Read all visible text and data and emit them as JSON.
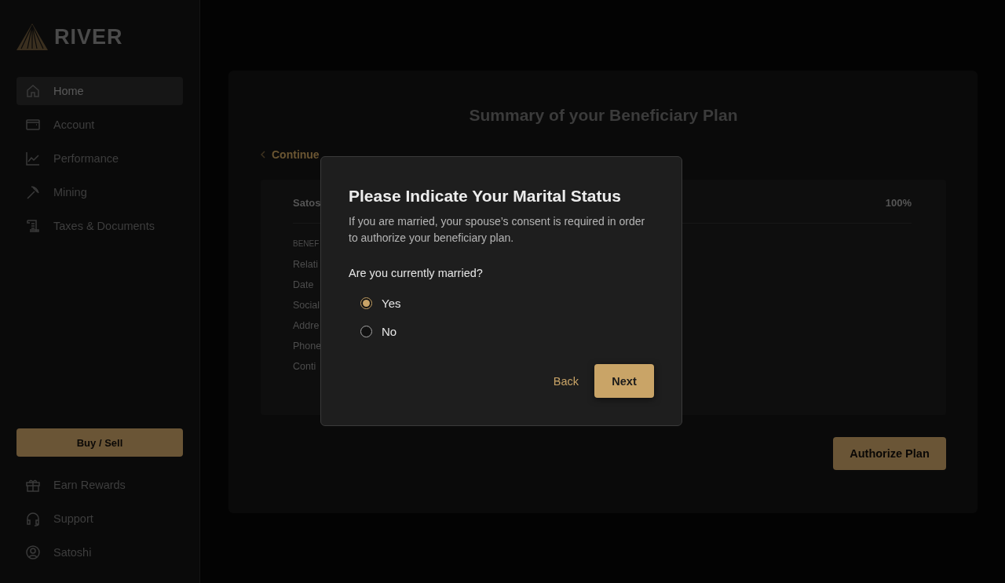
{
  "sidebar": {
    "logo": "RIVER",
    "items": [
      {
        "label": "Home",
        "selected": true
      },
      {
        "label": "Account",
        "selected": false
      },
      {
        "label": "Performance",
        "selected": false
      },
      {
        "label": "Mining",
        "selected": false
      },
      {
        "label": "Taxes & Documents",
        "selected": false
      }
    ],
    "action": "Buy / Sell",
    "footer_items": [
      {
        "label": "Earn Rewards"
      },
      {
        "label": "Support"
      },
      {
        "label": "Satoshi"
      }
    ]
  },
  "page": {
    "title": "Summary of your Beneficiary Plan",
    "back_link": "Continue",
    "beneficiary": {
      "name": "Satos",
      "share": "100%",
      "section": "BENEF",
      "fields": [
        "Relati",
        "Date",
        "Social",
        "Addre",
        "Phone",
        "Conti"
      ]
    },
    "authorize": "Authorize Plan"
  },
  "dialog": {
    "title": "Please Indicate Your Marital Status",
    "text": "If you are married, your spouse’s consent is required in order to authorize your beneficiary plan.",
    "question": "Are you currently married?",
    "options": [
      {
        "label": "Yes",
        "selected": true
      },
      {
        "label": "No",
        "selected": false
      }
    ],
    "back": "Back",
    "next": "Next"
  }
}
